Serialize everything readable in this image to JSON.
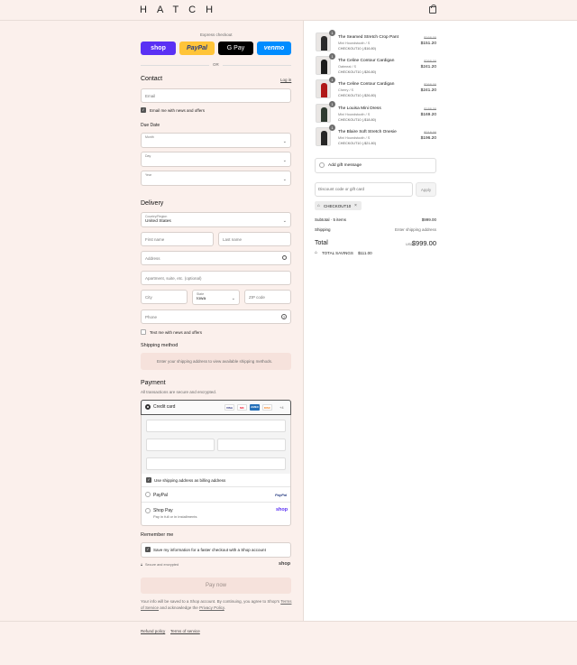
{
  "header": {
    "brand": "HATCH"
  },
  "express": {
    "title": "Express checkout",
    "shop": "shop",
    "paypal": "PayPal",
    "gpay": "G Pay",
    "venmo": "venmo",
    "or": "OR"
  },
  "contact": {
    "title": "Contact",
    "login": "Log in",
    "email_placeholder": "Email",
    "news_label": "Email me with news and offers"
  },
  "due_date": {
    "title": "Due Date",
    "month": "Month",
    "day": "Day",
    "year": "Year"
  },
  "delivery": {
    "title": "Delivery",
    "country_caption": "Country/Region",
    "country_value": "United States",
    "first_name": "First name",
    "last_name": "Last name",
    "address": "Address",
    "apartment": "Apartment, suite, etc. (optional)",
    "city": "City",
    "state_caption": "State",
    "state_value": "Iowa",
    "zip": "ZIP code",
    "phone": "Phone",
    "text_label": "Text me with news and offers"
  },
  "shipping": {
    "title": "Shipping method",
    "note": "Enter your shipping address to view available shipping methods."
  },
  "payment": {
    "title": "Payment",
    "subtitle": "All transactions are secure and encrypted.",
    "credit_card": "Credit card",
    "card_logos": [
      "VISA",
      "MC",
      "AMEX",
      "DISC"
    ],
    "more": "+4",
    "billing_label": "Use shipping address as billing address",
    "paypal_label": "PayPal",
    "paypal_logo": "PayPal",
    "shoppay_label": "Shop Pay",
    "shoppay_sub": "Pay in full or in installments",
    "shoppay_logo": "shop"
  },
  "remember": {
    "title": "Remember me",
    "label": "Save my information for a faster checkout with a Shop account",
    "secure": "Secure and encrypted",
    "shop_logo": "shop"
  },
  "pay_now": "Pay now",
  "legal": {
    "line1": "Your info will be saved to a Shop account. By continuing, you agree to Shop's",
    "tos": "Terms of Service",
    "mid": "and acknowledge the",
    "privacy": "Privacy Policy",
    "end": "."
  },
  "footer": {
    "refund": "Refund policy",
    "terms": "Terms of service"
  },
  "cart": {
    "items": [
      {
        "qty": "1",
        "name": "The Seamed Stretch Crop Pant",
        "variant": "Mini Houndstooth / S",
        "discount": "CHECKOUT10 (-$16.80)",
        "old": "$168.00",
        "price": "$151.20",
        "color": "#2b2b2b"
      },
      {
        "qty": "1",
        "name": "The Celine Contour Cardigan",
        "variant": "Oatmeal / S",
        "discount": "CHECKOUT10 (-$26.80)",
        "old": "$268.00",
        "price": "$241.20",
        "color": "#1c1c1c"
      },
      {
        "qty": "1",
        "name": "The Celine Contour Cardigan",
        "variant": "Cherry / S",
        "discount": "CHECKOUT10 (-$26.80)",
        "old": "$268.00",
        "price": "$241.20",
        "color": "#b01818"
      },
      {
        "qty": "1",
        "name": "The Louisa Mini Dress",
        "variant": "Mini Houndstooth / S",
        "discount": "CHECKOUT10 (-$18.80)",
        "old": "$188.00",
        "price": "$169.20",
        "color": "#2f3a30"
      },
      {
        "qty": "1",
        "name": "The Blaire Soft Stretch Onesie",
        "variant": "Mini Houndstooth / S",
        "discount": "CHECKOUT10 (-$21.80)",
        "old": "$218.00",
        "price": "$196.20",
        "color": "#262626"
      }
    ],
    "gift": "Add gift message",
    "discount_placeholder": "Discount code or gift card",
    "apply": "Apply",
    "applied_code": "CHECKOUT10",
    "subtotal_label": "Subtotal · 5 items",
    "subtotal": "$999.00",
    "shipping_label": "Shipping",
    "shipping_value": "Enter shipping address",
    "total_label": "Total",
    "currency": "USD",
    "total": "$999.00",
    "savings_label": "TOTAL SAVINGS",
    "savings": "$111.00"
  },
  "colors": {
    "bg": "#fbf0ec",
    "shop": "#5a31f4",
    "paypal": "#ffc439",
    "venmo": "#008cff",
    "accent": "#333333"
  }
}
